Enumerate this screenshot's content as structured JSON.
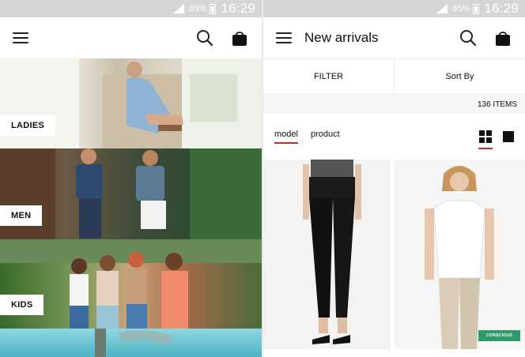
{
  "status_bar": {
    "battery_pct": "85%",
    "clock": "16:29"
  },
  "left_screen": {
    "icons": {
      "menu": "menu-icon",
      "search": "search-icon",
      "bag": "shopping-bag-icon"
    },
    "categories": [
      {
        "label": "LADIES"
      },
      {
        "label": "MEN"
      },
      {
        "label": "KIDS"
      },
      {
        "label": ""
      }
    ]
  },
  "right_screen": {
    "title": "New arrivals",
    "filter_label": "FILTER",
    "sort_label": "Sort By",
    "item_count": "136 ITEMS",
    "view_tabs": [
      {
        "label": "model",
        "active": true
      },
      {
        "label": "product",
        "active": false
      }
    ],
    "view_modes": {
      "grid": "grid-view-icon",
      "single": "single-view-icon"
    },
    "products": [
      {
        "name": "black-skinny-jeans",
        "badge": ""
      },
      {
        "name": "white-tshirt-beige-chinos",
        "badge": "CONSCIOUS",
        "badge_color": "#2e9a6a"
      }
    ]
  },
  "colors": {
    "accent": "#c62828",
    "statusbar": "#d6d6d6"
  }
}
